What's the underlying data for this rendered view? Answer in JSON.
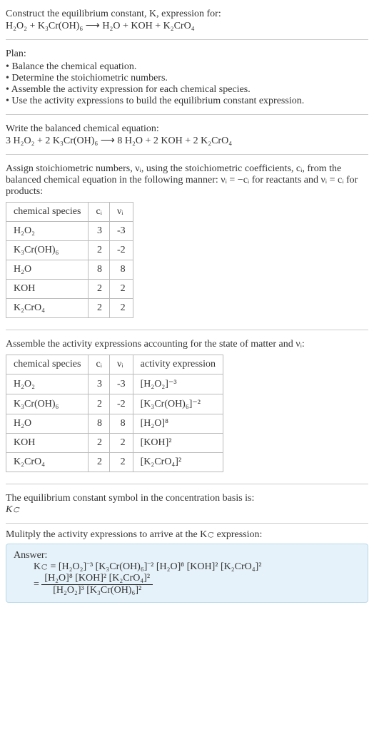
{
  "intro": {
    "line1": "Construct the equilibrium constant, K, expression for:",
    "equation": "H₂O₂ + K₃Cr(OH)₆ ⟶ H₂O + KOH + K₂CrO₄"
  },
  "plan": {
    "heading": "Plan:",
    "items": [
      "Balance the chemical equation.",
      "Determine the stoichiometric numbers.",
      "Assemble the activity expression for each chemical species.",
      "Use the activity expressions to build the equilibrium constant expression."
    ]
  },
  "balanced": {
    "heading": "Write the balanced chemical equation:",
    "equation": "3 H₂O₂ + 2 K₃Cr(OH)₆ ⟶ 8 H₂O + 2 KOH + 2 K₂CrO₄"
  },
  "stoich_text": "Assign stoichiometric numbers, νᵢ, using the stoichiometric coefficients, cᵢ, from the balanced chemical equation in the following manner: νᵢ = −cᵢ for reactants and νᵢ = cᵢ for products:",
  "table1": {
    "headers": [
      "chemical species",
      "cᵢ",
      "νᵢ"
    ],
    "rows": [
      [
        "H₂O₂",
        "3",
        "-3"
      ],
      [
        "K₃Cr(OH)₆",
        "2",
        "-2"
      ],
      [
        "H₂O",
        "8",
        "8"
      ],
      [
        "KOH",
        "2",
        "2"
      ],
      [
        "K₂CrO₄",
        "2",
        "2"
      ]
    ]
  },
  "activity_text": "Assemble the activity expressions accounting for the state of matter and νᵢ:",
  "table2": {
    "headers": [
      "chemical species",
      "cᵢ",
      "νᵢ",
      "activity expression"
    ],
    "rows": [
      [
        "H₂O₂",
        "3",
        "-3",
        "[H₂O₂]⁻³"
      ],
      [
        "K₃Cr(OH)₆",
        "2",
        "-2",
        "[K₃Cr(OH)₆]⁻²"
      ],
      [
        "H₂O",
        "8",
        "8",
        "[H₂O]⁸"
      ],
      [
        "KOH",
        "2",
        "2",
        "[KOH]²"
      ],
      [
        "K₂CrO₄",
        "2",
        "2",
        "[K₂CrO₄]²"
      ]
    ]
  },
  "symbol": {
    "line1": "The equilibrium constant symbol in the concentration basis is:",
    "line2": "K𝚌"
  },
  "multiply_text": "Mulitply the activity expressions to arrive at the K𝚌 expression:",
  "answer": {
    "label": "Answer:",
    "line1": "K𝚌 = [H₂O₂]⁻³ [K₃Cr(OH)₆]⁻² [H₂O]⁸ [KOH]² [K₂CrO₄]²",
    "eq": "=",
    "frac_num": "[H₂O]⁸ [KOH]² [K₂CrO₄]²",
    "frac_den": "[H₂O₂]³ [K₃Cr(OH)₆]²"
  },
  "chart_data": {
    "type": "table",
    "tables": [
      {
        "title": "Stoichiometric numbers",
        "columns": [
          "chemical species",
          "c_i",
          "nu_i"
        ],
        "rows": [
          {
            "chemical species": "H2O2",
            "c_i": 3,
            "nu_i": -3
          },
          {
            "chemical species": "K3Cr(OH)6",
            "c_i": 2,
            "nu_i": -2
          },
          {
            "chemical species": "H2O",
            "c_i": 8,
            "nu_i": 8
          },
          {
            "chemical species": "KOH",
            "c_i": 2,
            "nu_i": 2
          },
          {
            "chemical species": "K2CrO4",
            "c_i": 2,
            "nu_i": 2
          }
        ]
      },
      {
        "title": "Activity expressions",
        "columns": [
          "chemical species",
          "c_i",
          "nu_i",
          "activity expression"
        ],
        "rows": [
          {
            "chemical species": "H2O2",
            "c_i": 3,
            "nu_i": -3,
            "activity expression": "[H2O2]^-3"
          },
          {
            "chemical species": "K3Cr(OH)6",
            "c_i": 2,
            "nu_i": -2,
            "activity expression": "[K3Cr(OH)6]^-2"
          },
          {
            "chemical species": "H2O",
            "c_i": 8,
            "nu_i": 8,
            "activity expression": "[H2O]^8"
          },
          {
            "chemical species": "KOH",
            "c_i": 2,
            "nu_i": 2,
            "activity expression": "[KOH]^2"
          },
          {
            "chemical species": "K2CrO4",
            "c_i": 2,
            "nu_i": 2,
            "activity expression": "[K2CrO4]^2"
          }
        ]
      }
    ]
  }
}
